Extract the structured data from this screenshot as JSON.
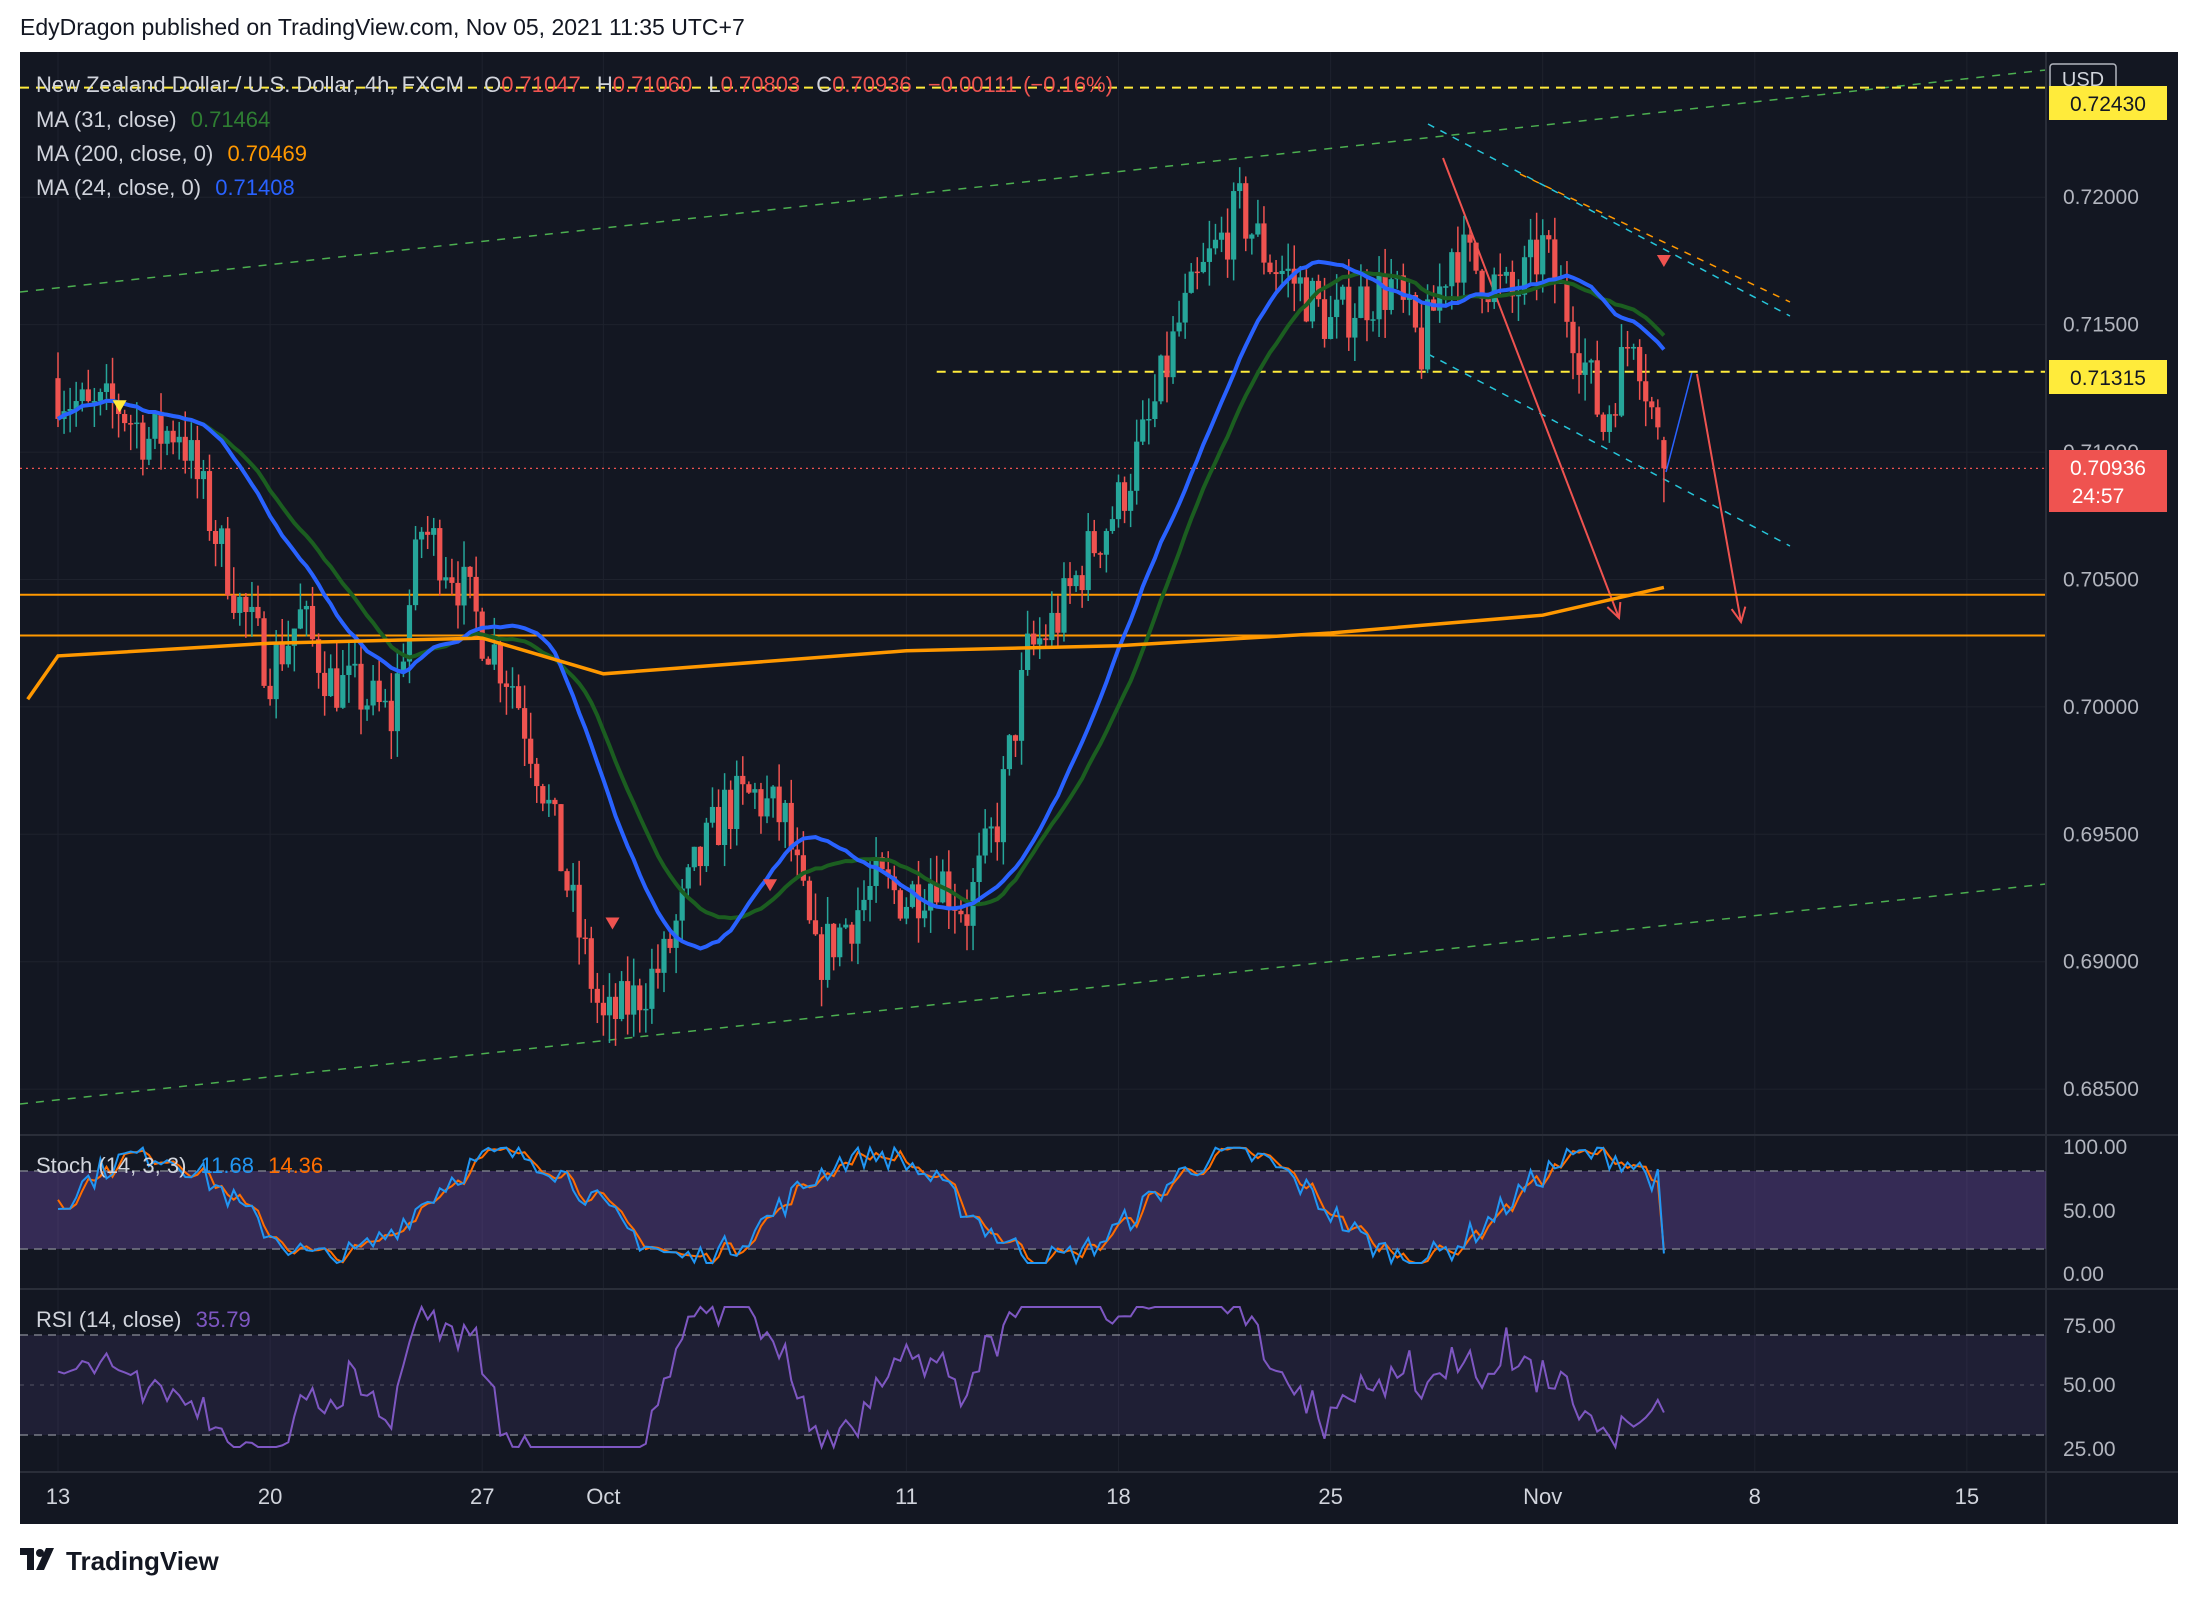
{
  "header": {
    "publisher_text": "EdyDragon published on TradingView.com, Nov 05, 2021 11:35 UTC+7"
  },
  "footer": {
    "brand": "TradingView"
  },
  "legend": {
    "symbol": "New Zealand Dollar / U.S. Dollar, 4h, FXCM",
    "o_label": "O",
    "o_value": "0.71047",
    "h_label": "H",
    "h_value": "0.71060",
    "l_label": "L",
    "l_value": "0.70803",
    "c_label": "C",
    "c_value": "0.70936",
    "change": "−0.00111 (−0.16%)",
    "ma31_label": "MA (31, close)",
    "ma31_value": "0.71464",
    "ma200_label": "MA (200, close, 0)",
    "ma200_value": "0.70469",
    "ma24_label": "MA (24, close, 0)",
    "ma24_value": "0.71408",
    "stoch_label": "Stoch (14, 3, 3)",
    "stoch_k": "11.68",
    "stoch_d": "14.36",
    "rsi_label": "RSI (14, close)",
    "rsi_value": "35.79"
  },
  "price_axis": {
    "currency": "USD",
    "ticks": [
      "0.72000",
      "0.71500",
      "0.71000",
      "0.70500",
      "0.70000",
      "0.69500",
      "0.69000",
      "0.68500"
    ],
    "tag_top": "0.72430",
    "tag_mid": "0.71315",
    "tag_last": "0.70936",
    "tag_countdown": "24:57"
  },
  "time_axis": [
    "13",
    "20",
    "27",
    "Oct",
    "11",
    "18",
    "25",
    "Nov",
    "8",
    "15"
  ],
  "stoch_axis": [
    "100.00",
    "50.00",
    "0.00"
  ],
  "rsi_axis": [
    "75.00",
    "50.00",
    "25.00"
  ],
  "colors": {
    "background": "#131722",
    "up": "#26a69a",
    "down": "#ef5350",
    "ma31": "#1b5e20",
    "ma200": "#ff9800",
    "ma24": "#2962ff",
    "stoch_k": "#2196f3",
    "stoch_d": "#ff6d00",
    "rsi": "#7e57c2",
    "hline_yellow": "#ffeb3b",
    "support_orange": "#ff9800"
  },
  "chart_data": [
    {
      "type": "candlestick",
      "title": "New Zealand Dollar / U.S. Dollar, 4h, FXCM",
      "timeframe": "4h",
      "x_range": [
        "2021-09-13",
        "2021-11-15"
      ],
      "ylim": [
        0.6832,
        0.7257
      ],
      "last_candle": {
        "open": 0.71047,
        "high": 0.7106,
        "low": 0.70803,
        "close": 0.70936
      },
      "close_path": [
        {
          "date": "2021-09-13",
          "close": 0.7125
        },
        {
          "date": "2021-09-14",
          "close": 0.7115
        },
        {
          "date": "2021-09-15",
          "close": 0.7118
        },
        {
          "date": "2021-09-16",
          "close": 0.7105
        },
        {
          "date": "2021-09-17",
          "close": 0.711
        },
        {
          "date": "2021-09-18",
          "close": 0.7075
        },
        {
          "date": "2021-09-19",
          "close": 0.704
        },
        {
          "date": "2021-09-20",
          "close": 0.7015
        },
        {
          "date": "2021-09-21",
          "close": 0.7035
        },
        {
          "date": "2021-09-22",
          "close": 0.701
        },
        {
          "date": "2021-09-23",
          "close": 0.7005
        },
        {
          "date": "2021-09-24",
          "close": 0.6995
        },
        {
          "date": "2021-09-25",
          "close": 0.707
        },
        {
          "date": "2021-09-26",
          "close": 0.7055
        },
        {
          "date": "2021-09-27",
          "close": 0.703
        },
        {
          "date": "2021-09-28",
          "close": 0.701
        },
        {
          "date": "2021-09-29",
          "close": 0.697
        },
        {
          "date": "2021-09-30",
          "close": 0.692
        },
        {
          "date": "2021-10-01",
          "close": 0.6875
        },
        {
          "date": "2021-10-02",
          "close": 0.6885
        },
        {
          "date": "2021-10-03",
          "close": 0.69
        },
        {
          "date": "2021-10-04",
          "close": 0.6935
        },
        {
          "date": "2021-10-05",
          "close": 0.696
        },
        {
          "date": "2021-10-06",
          "close": 0.6965
        },
        {
          "date": "2021-10-07",
          "close": 0.6955
        },
        {
          "date": "2021-10-08",
          "close": 0.69
        },
        {
          "date": "2021-10-09",
          "close": 0.6915
        },
        {
          "date": "2021-10-10",
          "close": 0.693
        },
        {
          "date": "2021-10-11",
          "close": 0.6925
        },
        {
          "date": "2021-10-12",
          "close": 0.6935
        },
        {
          "date": "2021-10-13",
          "close": 0.692
        },
        {
          "date": "2021-10-14",
          "close": 0.6955
        },
        {
          "date": "2021-10-15",
          "close": 0.702
        },
        {
          "date": "2021-10-16",
          "close": 0.7035
        },
        {
          "date": "2021-10-17",
          "close": 0.706
        },
        {
          "date": "2021-10-18",
          "close": 0.708
        },
        {
          "date": "2021-10-19",
          "close": 0.711
        },
        {
          "date": "2021-10-20",
          "close": 0.715
        },
        {
          "date": "2021-10-21",
          "close": 0.7175
        },
        {
          "date": "2021-10-22",
          "close": 0.7195
        },
        {
          "date": "2021-10-23",
          "close": 0.7175
        },
        {
          "date": "2021-10-24",
          "close": 0.7165
        },
        {
          "date": "2021-10-25",
          "close": 0.715
        },
        {
          "date": "2021-10-26",
          "close": 0.716
        },
        {
          "date": "2021-10-27",
          "close": 0.7165
        },
        {
          "date": "2021-10-28",
          "close": 0.714
        },
        {
          "date": "2021-10-29",
          "close": 0.718
        },
        {
          "date": "2021-10-30",
          "close": 0.717
        },
        {
          "date": "2021-10-31",
          "close": 0.716
        },
        {
          "date": "2021-11-01",
          "close": 0.718
        },
        {
          "date": "2021-11-02",
          "close": 0.715
        },
        {
          "date": "2021-11-03",
          "close": 0.711
        },
        {
          "date": "2021-11-04",
          "close": 0.715
        },
        {
          "date": "2021-11-05",
          "close": 0.70936
        }
      ],
      "indicators": {
        "ma31_last": 0.71464,
        "ma200_last": 0.70469,
        "ma24_last": 0.71408,
        "ma200_path": [
          {
            "date": "2021-09-13",
            "value": 0.702
          },
          {
            "date": "2021-09-20",
            "value": 0.7025
          },
          {
            "date": "2021-09-27",
            "value": 0.7027
          },
          {
            "date": "2021-10-01",
            "value": 0.7013
          },
          {
            "date": "2021-10-11",
            "value": 0.7022
          },
          {
            "date": "2021-10-18",
            "value": 0.7024
          },
          {
            "date": "2021-10-25",
            "value": 0.7029
          },
          {
            "date": "2021-11-01",
            "value": 0.7036
          },
          {
            "date": "2021-11-05",
            "value": 0.70469
          }
        ]
      },
      "levels": [
        {
          "value": 0.7243,
          "style": "dashed",
          "color": "yellow"
        },
        {
          "value": 0.71315,
          "style": "dashed",
          "color": "yellow"
        },
        {
          "value": 0.7044,
          "style": "solid",
          "color": "orange"
        },
        {
          "value": 0.7028,
          "style": "solid",
          "color": "orange"
        }
      ]
    },
    {
      "type": "line",
      "title": "Stoch (14, 3, 3)",
      "ylim": [
        0,
        100
      ],
      "bands": [
        20,
        80
      ],
      "series": [
        {
          "name": "%K",
          "last": 11.68
        },
        {
          "name": "%D",
          "last": 14.36
        }
      ]
    },
    {
      "type": "line",
      "title": "RSI (14, close)",
      "ylim": [
        20,
        80
      ],
      "bands": [
        30,
        70
      ],
      "series": [
        {
          "name": "RSI",
          "last": 35.79
        }
      ]
    }
  ]
}
